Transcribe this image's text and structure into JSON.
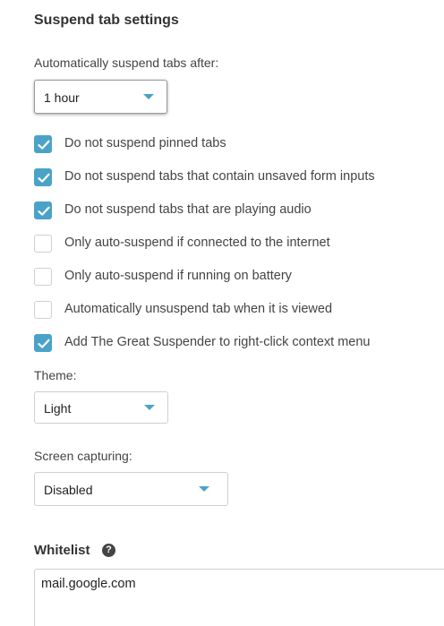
{
  "section_title": "Suspend tab settings",
  "suspend_after": {
    "label": "Automatically suspend tabs after:",
    "value": "1 hour"
  },
  "options": [
    {
      "label": "Do not suspend pinned tabs",
      "checked": true
    },
    {
      "label": "Do not suspend tabs that contain unsaved form inputs",
      "checked": true
    },
    {
      "label": "Do not suspend tabs that are playing audio",
      "checked": true
    },
    {
      "label": "Only auto-suspend if connected to the internet",
      "checked": false
    },
    {
      "label": "Only auto-suspend if running on battery",
      "checked": false
    },
    {
      "label": "Automatically unsuspend tab when it is viewed",
      "checked": false
    },
    {
      "label": "Add The Great Suspender to right-click context menu",
      "checked": true
    }
  ],
  "theme": {
    "label": "Theme:",
    "value": "Light"
  },
  "screen_capturing": {
    "label": "Screen capturing:",
    "value": "Disabled"
  },
  "whitelist": {
    "title": "Whitelist",
    "help_glyph": "?",
    "value": "mail.google.com"
  },
  "colors": {
    "accent": "#4aa3c7",
    "text": "#444444"
  }
}
